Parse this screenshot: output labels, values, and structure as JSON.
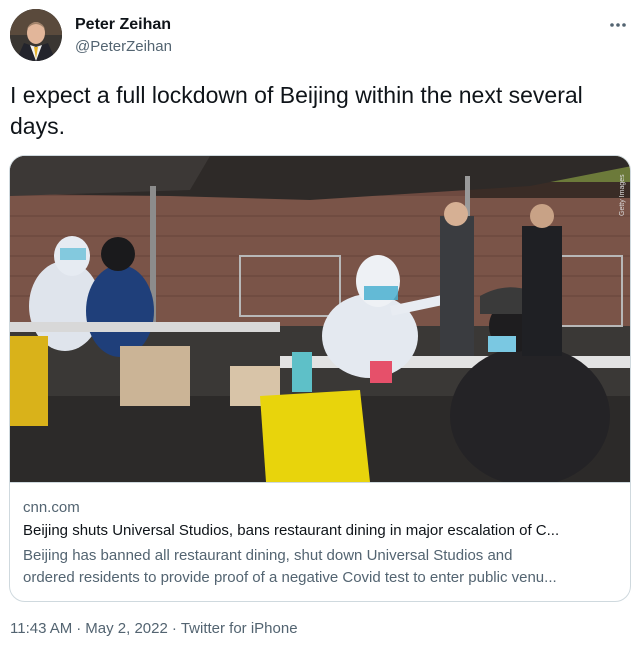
{
  "author": {
    "name": "Peter Zeihan",
    "handle": "@PeterZeihan"
  },
  "tweet": {
    "text": "I expect a full lockdown of Beijing within the next several days."
  },
  "card": {
    "domain": "cnn.com",
    "title": "Beijing shuts Universal Studios, bans restaurant dining in major escalation of C...",
    "description_line1": "Beijing has banned all restaurant dining, shut down Universal Studios and",
    "description_line2": "ordered residents to provide proof of a negative Covid test to enter public venu...",
    "image_credit": "Getty Images"
  },
  "meta": {
    "time": "11:43 AM",
    "separator": "·",
    "date": "May 2, 2022",
    "source": "Twitter for iPhone"
  },
  "icons": {
    "more": "more-horizontal-icon"
  },
  "colors": {
    "text_primary": "#0f1419",
    "text_secondary": "#536471",
    "border": "#cfd9de"
  }
}
